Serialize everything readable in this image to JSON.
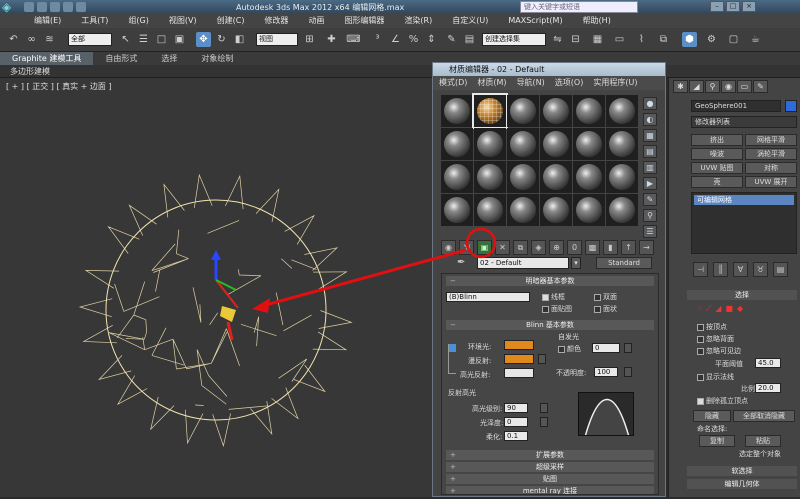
{
  "app": {
    "title": "Autodesk 3ds Max  2012 x64    编辑网格.max",
    "search_placeholder": "键入关键字或短语",
    "window_buttons": [
      "–",
      "□",
      "×"
    ]
  },
  "menu": [
    "编辑(E)",
    "工具(T)",
    "组(G)",
    "视图(V)",
    "创建(C)",
    "修改器",
    "动画",
    "图形编辑器",
    "渲染(R)",
    "自定义(U)",
    "MAXScript(M)",
    "帮助(H)"
  ],
  "toolbar": {
    "selection_filter": "全部",
    "ref_coord": "视图",
    "named_selection": "创建选择集"
  },
  "ribbon": {
    "tabs": [
      "Graphite 建模工具",
      "自由形式",
      "选择",
      "对象绘制"
    ],
    "sub_label": "多边形建模"
  },
  "viewport": {
    "label": "[ + ] [ 正交 ] [ 真实 + 边面 ]"
  },
  "command_panel": {
    "object_name": "GeoSphere001",
    "modifier_list": "修改器列表",
    "buttons": [
      "挤出",
      "网格平滑",
      "噪波",
      "涡轮平滑",
      "UVW 贴图",
      "对称",
      "壳",
      "UVW 展开"
    ],
    "stack_item": "可编辑网格",
    "selection_rollout": "选择",
    "checks": [
      "按顶点",
      "忽略背面",
      "忽略可见边",
      "显示法线"
    ],
    "planar_thresh_label": "平面阈值",
    "planar_thresh_value": "45.0",
    "scale_label": "比例",
    "scale_value": "20.0",
    "delete_iso_label": "删除孤立顶点",
    "hide_btn": "隐藏",
    "unhide_all_btn": "全部取消隐藏",
    "named_sel_label": "命名选择:",
    "copy_btn": "复制",
    "paste_btn": "粘贴",
    "status": "选定整个对象",
    "soft_sel_rollout": "软选择",
    "edit_geom_rollout": "编辑几何体"
  },
  "material_editor": {
    "title": "材质编辑器 - 02 - Default",
    "menu": [
      "模式(D)",
      "材质(M)",
      "导航(N)",
      "选项(O)",
      "实用程序(U)"
    ],
    "material_name": "02 - Default",
    "material_type": "Standard",
    "shader_rollout": "明暗器基本参数",
    "shader_type": "(B)Blinn",
    "shader_checks": [
      {
        "label": "线框",
        "checked": true
      },
      {
        "label": "双面",
        "checked": false
      },
      {
        "label": "面贴图",
        "checked": false
      },
      {
        "label": "面状",
        "checked": false
      }
    ],
    "blinn_rollout": "Blinn 基本参数",
    "self_illum_label": "自发光",
    "color_label": "颜色",
    "color_value": "0",
    "ambient_label": "环境光:",
    "diffuse_label": "漫反射:",
    "specular_label": "高光反射:",
    "opacity_label": "不透明度:",
    "opacity_value": "100",
    "spec_highlights_label": "反射高光",
    "spec_level_label": "高光级别:",
    "spec_level_value": "90",
    "glossiness_label": "光泽度:",
    "glossiness_value": "0",
    "soften_label": "柔化:",
    "soften_value": "0.1",
    "colors": {
      "ambient": "#e08a1e",
      "diffuse": "#e08a1e",
      "specular": "#e6e6e6"
    },
    "bottom_rollouts": [
      "扩展参数",
      "超级采样",
      "贴图",
      "mental ray 连接"
    ]
  }
}
